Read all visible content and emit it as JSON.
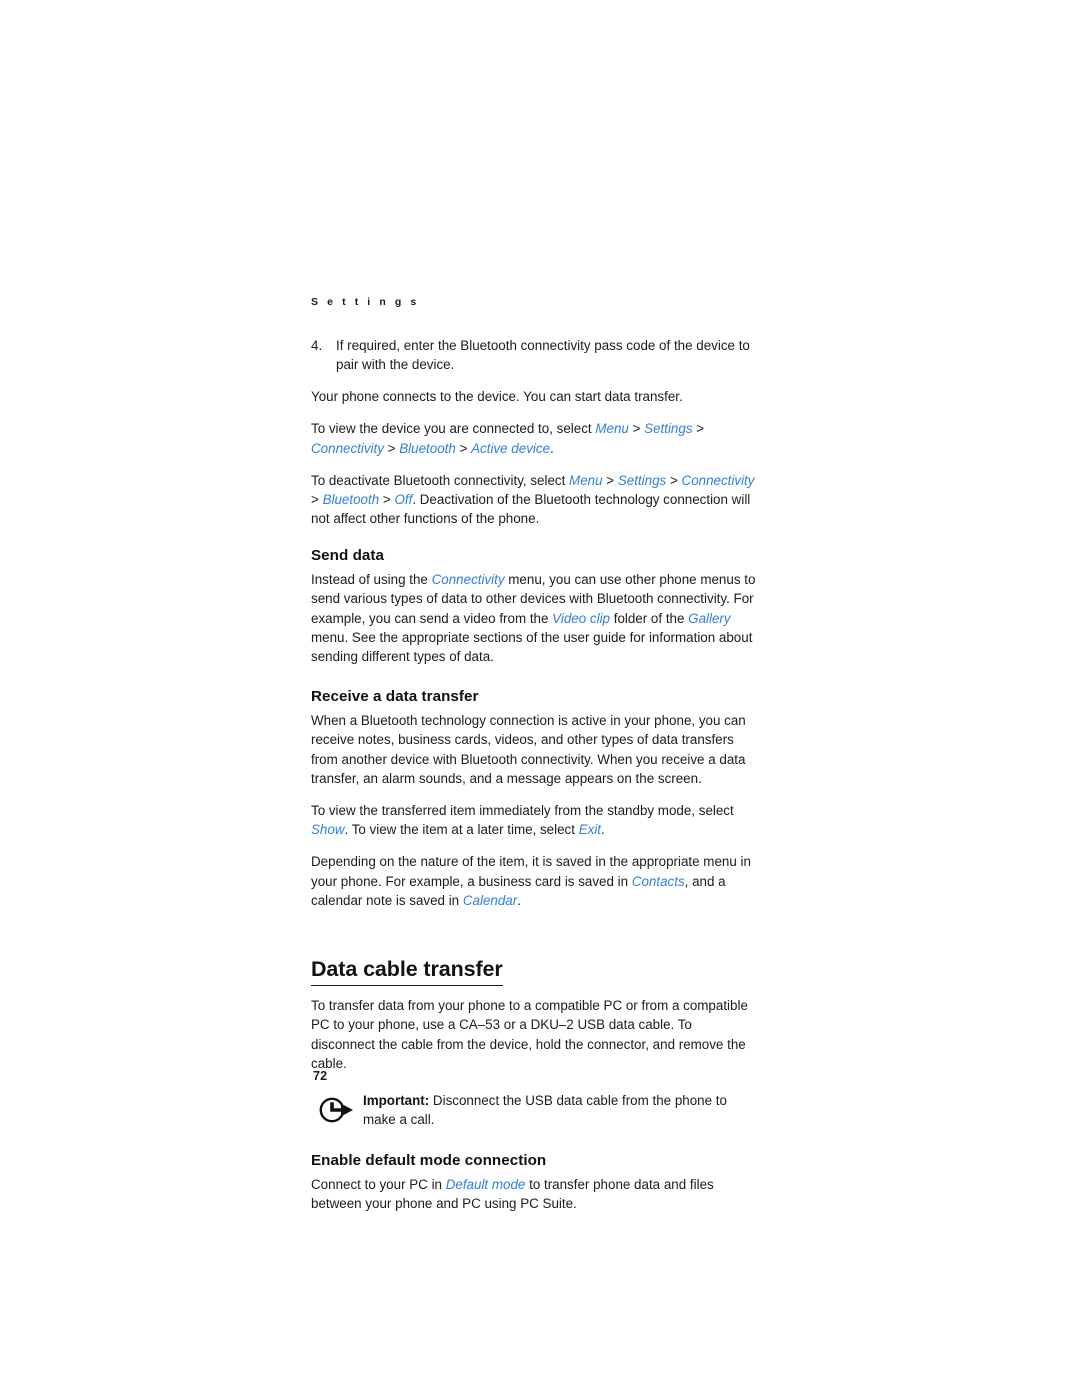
{
  "page": {
    "running_head": "S e t t i n g s",
    "page_number": "72",
    "accent_color": "#2f7fe0",
    "text_color": "#1c1c1c",
    "background_color": "#ffffff"
  },
  "step": {
    "marker": "4.",
    "text": "If required, enter the Bluetooth connectivity pass code of the device to pair with the device."
  },
  "paragraphs": {
    "connects": "Your phone connects to the device. You can start data transfer.",
    "view_device_lead": "To view the device you are connected to, select ",
    "deactivate_lead": "To deactivate Bluetooth connectivity, select ",
    "deactivate_tail": ". Deactivation of the Bluetooth technology connection will not affect other functions of the phone."
  },
  "refs": {
    "menu": "Menu",
    "settings": "Settings",
    "connectivity": "Connectivity",
    "bluetooth": "Bluetooth",
    "active_device": "Active device",
    "off": "Off",
    "video_clip": "Video clip",
    "gallery": "Gallery",
    "show": "Show",
    "exit": "Exit",
    "contacts": "Contacts",
    "calendar": "Calendar",
    "default_mode": "Default mode",
    "separator": ">",
    "period": ".",
    "comma": ","
  },
  "send_data": {
    "heading": "Send data",
    "text_a": "Instead of using the ",
    "text_b": " menu, you can use other phone menus to send various types of data to other devices with Bluetooth connectivity. For example, you can send a video from the ",
    "text_c": " folder of the ",
    "text_d": " menu. See the appropriate sections of the user guide for information about sending different types of data."
  },
  "receive_data": {
    "heading": "Receive a data transfer",
    "paragraph_1": "When a Bluetooth technology connection is active in your phone, you can receive notes, business cards, videos, and other types of data transfers from another device with Bluetooth connectivity. When you receive a data transfer, an alarm sounds, and a message appears on the screen.",
    "paragraph_2_a": "To view the transferred item immediately from the standby mode, select ",
    "paragraph_2_b": ". To view the item at a later time, select ",
    "paragraph_2_c": ".",
    "paragraph_3_a": "Depending on the nature of the item, it is saved in the appropriate menu in your phone. For example, a business card is saved in ",
    "paragraph_3_b": ", and a calendar note is saved in ",
    "paragraph_3_c": "."
  },
  "data_cable": {
    "heading": "Data cable transfer",
    "paragraph": "To transfer data from your phone to a compatible PC or from a compatible PC to your phone, use a CA–53 or a DKU–2 USB data cable. To disconnect the cable from the device, hold the connector, and remove the cable.",
    "note_icon_name": "important-note-arrow-icon",
    "note_lead": "Important:",
    "note_body": " Disconnect the USB data cable from the phone to make a call."
  },
  "default_mode_section": {
    "heading": "Enable default mode connection",
    "text_a": "Connect to your PC in ",
    "text_b": " to transfer phone data and files between your phone and PC using PC Suite."
  }
}
